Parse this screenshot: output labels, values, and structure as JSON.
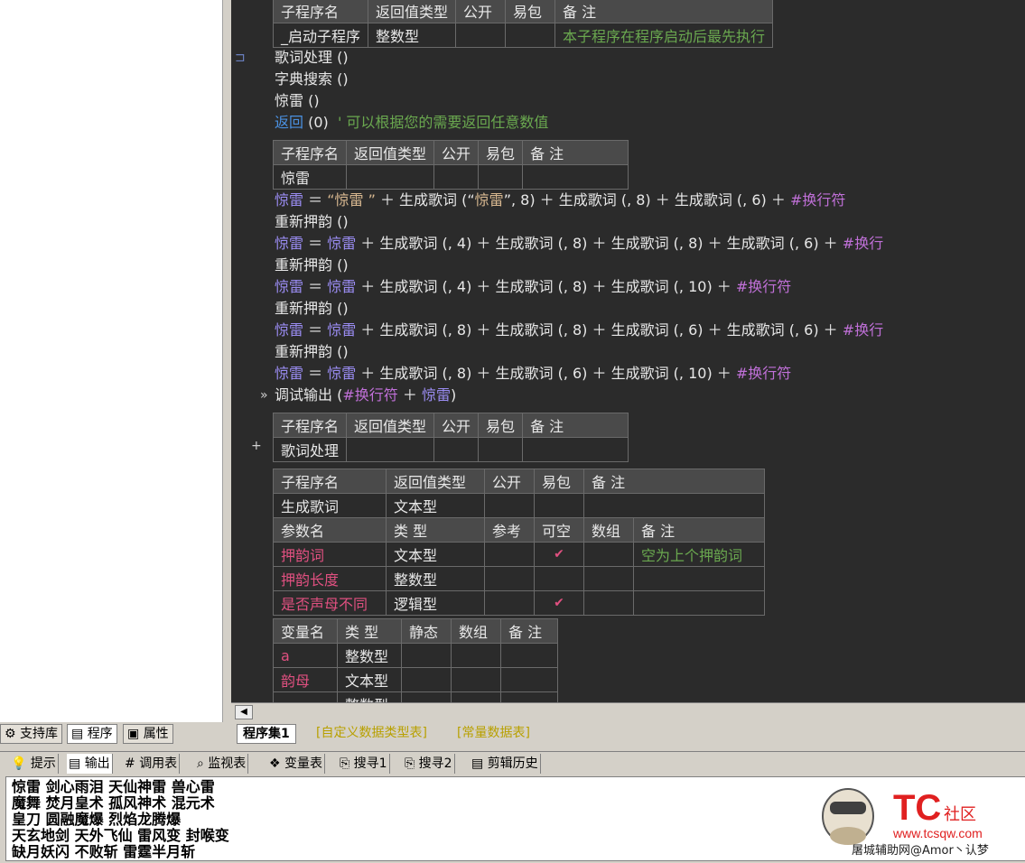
{
  "editor": {
    "table1": {
      "headers": [
        "子程序名",
        "返回值类型",
        "公开",
        "易包",
        "备 注"
      ],
      "row": [
        "_启动子程序",
        "整数型",
        "",
        "",
        "本子程序在程序启动后最先执行"
      ]
    },
    "code_lines_a": [
      {
        "text": "歌词处理 ()"
      },
      {
        "text": "字典搜索 ()"
      },
      {
        "text": "惊雷 ()"
      }
    ],
    "return_kw": "返回",
    "return_arg": " (0)  ",
    "return_comment": "' 可以根据您的需要返回任意数值",
    "table2": {
      "headers": [
        "子程序名",
        "返回值类型",
        "公开",
        "易包",
        "备 注"
      ],
      "row": [
        "惊雷",
        "",
        "",
        "",
        ""
      ]
    },
    "line_l1": {
      "var": "惊雷",
      "eq": " ＝ ",
      "str": "“惊雷 ”",
      "rest": " ＋ 生成歌词 (“",
      "str2": "惊雷",
      "rest2": "”, 8) ＋ 生成歌词 (, 8) ＋ 生成歌词 (, 6) ＋ ",
      "macro": "#换行符"
    },
    "rhyme": "重新押韵 ()",
    "line_l2": {
      "var": "惊雷",
      "eq": " ＝ ",
      "var2": "惊雷",
      "rest": " ＋ 生成歌词 (, 4) ＋ 生成歌词 (, 8) ＋ 生成歌词 (, 8) ＋ 生成歌词 (, 6) ＋ ",
      "macro": "#换行"
    },
    "line_l3": {
      "var": "惊雷",
      "eq": " ＝ ",
      "var2": "惊雷",
      "rest": " ＋ 生成歌词 (, 4) ＋ 生成歌词 (, 8) ＋ 生成歌词 (, 10) ＋ ",
      "macro": "#换行符"
    },
    "line_l4": {
      "var": "惊雷",
      "eq": " ＝ ",
      "var2": "惊雷",
      "rest": " ＋ 生成歌词 (, 8) ＋ 生成歌词 (, 8) ＋ 生成歌词 (, 6) ＋ 生成歌词 (, 6) ＋ ",
      "macro": "#换行"
    },
    "line_l5": {
      "var": "惊雷",
      "eq": " ＝ ",
      "var2": "惊雷",
      "rest": " ＋ 生成歌词 (, 8) ＋ 生成歌词 (, 6) ＋ 生成歌词 (, 10) ＋ ",
      "macro": "#换行符"
    },
    "debug": {
      "fn": "调试输出 (",
      "macro": "#换行符",
      "plus": " ＋ ",
      "var": "惊雷",
      "close": ")"
    },
    "table3": {
      "headers": [
        "子程序名",
        "返回值类型",
        "公开",
        "易包",
        "备 注"
      ],
      "row": [
        "歌词处理",
        "",
        "",
        "",
        ""
      ]
    },
    "table4": {
      "headers": [
        "子程序名",
        "返回值类型",
        "公开",
        "易包",
        "备 注"
      ],
      "row": [
        "生成歌词",
        "文本型",
        "",
        "",
        ""
      ],
      "param_headers": [
        "参数名",
        "类 型",
        "参考",
        "可空",
        "数组",
        "备 注"
      ],
      "params": [
        {
          "name": "押韵词",
          "type": "文本型",
          "ref": "",
          "nullable": "✔",
          "array": "",
          "note": "空为上个押韵词"
        },
        {
          "name": "押韵长度",
          "type": "整数型",
          "ref": "",
          "nullable": "",
          "array": "",
          "note": ""
        },
        {
          "name": "是否声母不同",
          "type": "逻辑型",
          "ref": "",
          "nullable": "✔",
          "array": "",
          "note": ""
        }
      ]
    },
    "table5": {
      "headers": [
        "变量名",
        "类 型",
        "静态",
        "数组",
        "备 注"
      ],
      "rows": [
        {
          "name": "a",
          "type": "整数型"
        },
        {
          "name": "韵母",
          "type": "文本型"
        },
        {
          "name": "",
          "type": "整数型"
        }
      ]
    }
  },
  "left_tabs": [
    "支持库",
    "程序",
    "属性"
  ],
  "editor_tabs": [
    "程序集1",
    "[自定义数据类型表]",
    "[常量数据表]"
  ],
  "output_tabs": [
    "提示",
    "输出",
    "调用表",
    "监视表",
    "变量表",
    "搜寻1",
    "搜寻2",
    "剪辑历史"
  ],
  "output_lines": [
    "惊雷 剑心雨泪 天仙神雷 兽心雷",
    "魔舞 焚月皇术 孤风神术 混元术",
    "皇刀 圆融魔爆 烈焰龙腾爆",
    "天玄地剑 天外飞仙 雷风变 封喉变",
    "缺月妖闪 不败斩 雷霆半月斩"
  ],
  "watermark": {
    "brand": "TC",
    "tag": "社区",
    "url": "www.tcsqw.com",
    "credit": "屠城辅助网@Amor丶认梦"
  }
}
